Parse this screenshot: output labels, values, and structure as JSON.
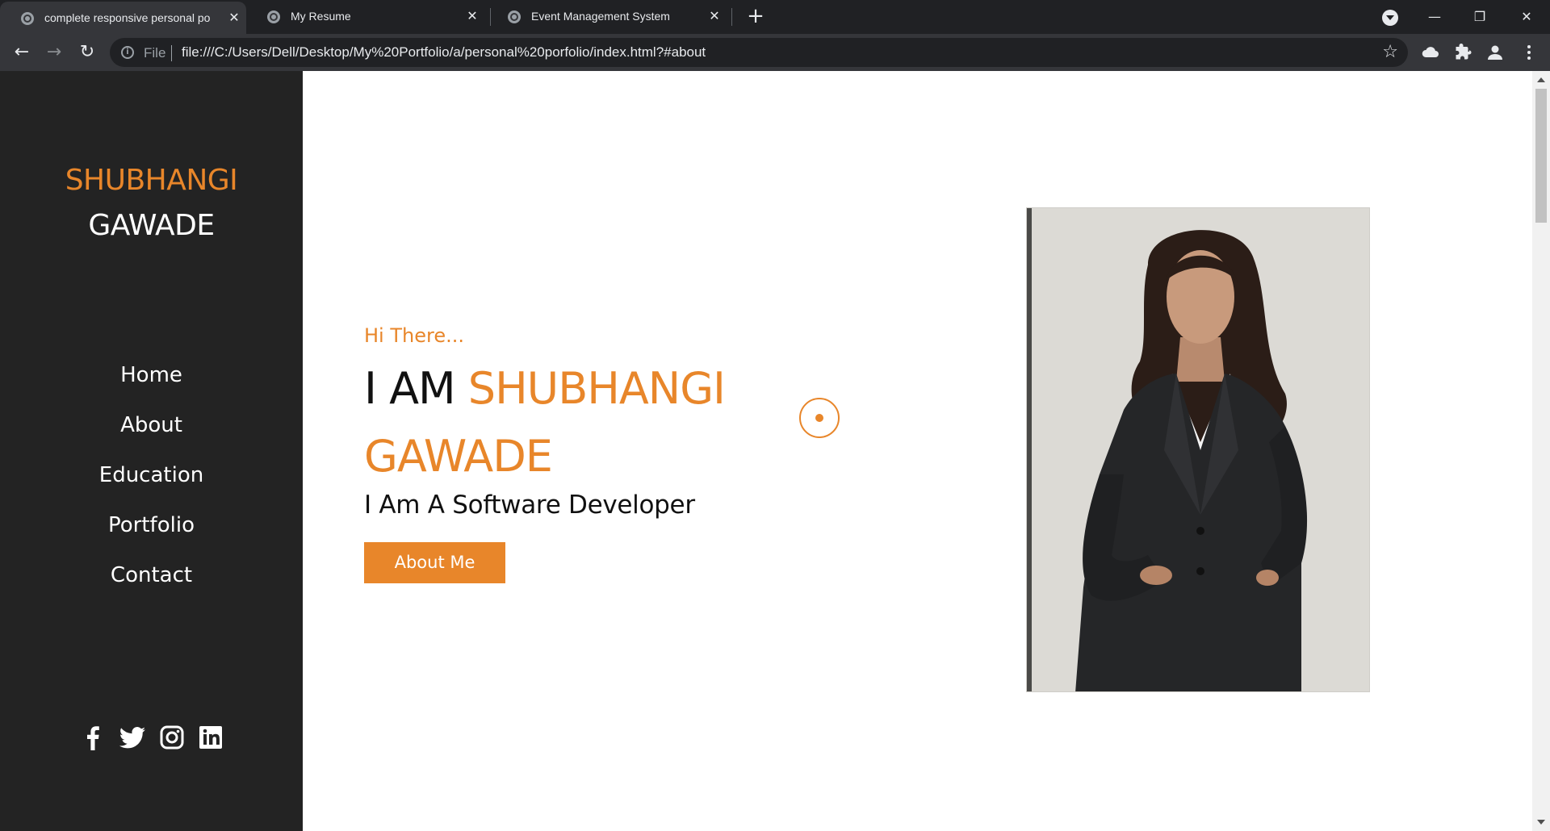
{
  "browser": {
    "tabs": [
      {
        "title": "complete responsive personal po",
        "active": true
      },
      {
        "title": "My Resume",
        "active": false
      },
      {
        "title": "Event Management System",
        "active": false
      }
    ],
    "new_tab_label": "+",
    "url_scheme": "File",
    "url": "file:///C:/Users/Dell/Desktop/My%20Portfolio/a/personal%20porfolio/index.html?#about"
  },
  "sidebar": {
    "logo_first": "SHUBHANGI",
    "logo_last": "GAWADE",
    "nav": [
      {
        "label": "Home"
      },
      {
        "label": "About"
      },
      {
        "label": "Education"
      },
      {
        "label": "Portfolio"
      },
      {
        "label": "Contact"
      }
    ],
    "social": [
      "facebook-icon",
      "twitter-icon",
      "instagram-icon",
      "linkedin-icon"
    ]
  },
  "hero": {
    "greeting": "Hi There...",
    "headline_prefix": "I AM ",
    "headline_name": "SHUBHANGI GAWADE",
    "role": "I Am A Software Developer",
    "button_label": "About Me"
  },
  "colors": {
    "accent": "#e8862a",
    "sidebar_bg": "#232323"
  }
}
